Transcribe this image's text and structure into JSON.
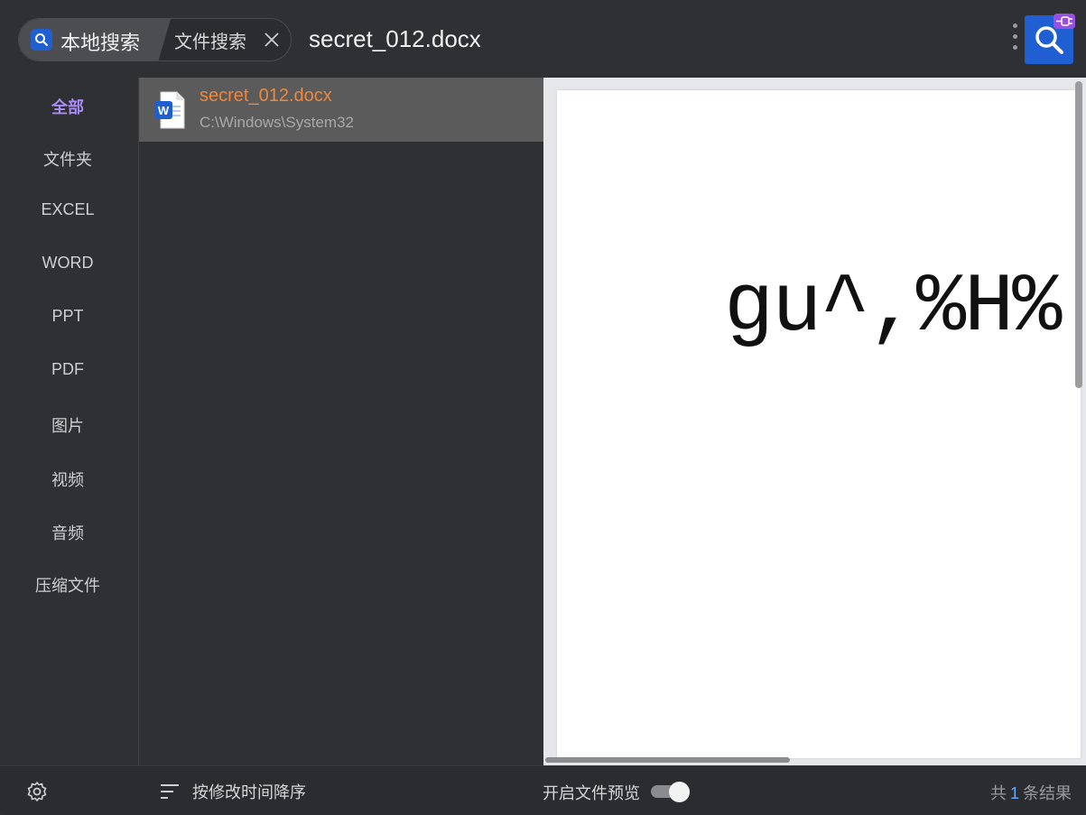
{
  "header": {
    "local_search_label": "本地搜索",
    "file_search_label": "文件搜索",
    "query": "secret_012.docx"
  },
  "sidebar": {
    "items": [
      {
        "label": "全部",
        "active": true
      },
      {
        "label": "文件夹"
      },
      {
        "label": "EXCEL"
      },
      {
        "label": "WORD"
      },
      {
        "label": "PPT"
      },
      {
        "label": "PDF"
      },
      {
        "label": "图片"
      },
      {
        "label": "视频"
      },
      {
        "label": "音频"
      },
      {
        "label": "压缩文件"
      }
    ]
  },
  "results": [
    {
      "name": "secret_012.docx",
      "path": "C:\\Windows\\System32",
      "icon": "word-doc-icon"
    }
  ],
  "preview": {
    "content": "gu^,%H%"
  },
  "footer": {
    "sort_label": "按修改时间降序",
    "preview_toggle_label": "开启文件预览",
    "preview_enabled": true,
    "count_prefix": "共",
    "count_value": "1",
    "count_suffix": "条结果"
  },
  "colors": {
    "accent_blue": "#1f5fd1",
    "active_category": "#a98cf5",
    "result_name": "#f0873a",
    "plugin_badge": "#9a4fe3"
  }
}
